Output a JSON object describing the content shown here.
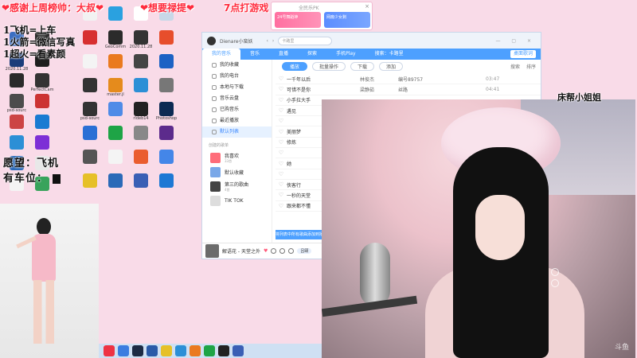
{
  "overlay": {
    "banner_left": "❤感谢上周榜帅：大叔❤",
    "banner_mid": "❤想要禄提❤",
    "banner_time": "7点打游戏",
    "rules": [
      "1飞机=上车",
      "1火箭=微信写真",
      "1超火=看素颜"
    ],
    "wish_title": "愿望：飞机",
    "wish_seats": "有车位：",
    "cam_label": "床帮小姐姐"
  },
  "pk_window": {
    "title": "全民乐PK",
    "left_label": "24号舞蹈神",
    "right_label": "网瘾少女剩",
    "close": "×"
  },
  "desktop_icons": [
    {
      "label": "",
      "color": "#3b6ec2"
    },
    {
      "label": "",
      "color": "#2a2a2a"
    },
    {
      "label": "",
      "color": "#f2f2f2"
    },
    {
      "label": "",
      "color": "#2aa1e0"
    },
    {
      "label": "",
      "color": "#ffffff"
    },
    {
      "label": "",
      "color": "#c8d8e8"
    },
    {
      "label": "2020.11.28",
      "color": "#1b3d7a"
    },
    {
      "label": "",
      "color": "#1e1e1e"
    },
    {
      "label": "",
      "color": "#d73030"
    },
    {
      "label": "GeoComm",
      "color": "#2b2b2b"
    },
    {
      "label": "2020.11.28",
      "color": "#333"
    },
    {
      "label": "",
      "color": "#e74e2c"
    },
    {
      "label": "",
      "color": "#2b2b2b"
    },
    {
      "label": "PerfectCam",
      "color": "#333"
    },
    {
      "label": "",
      "color": "#f4f4f4"
    },
    {
      "label": "",
      "color": "#ea7a1f"
    },
    {
      "label": "",
      "color": "#444"
    },
    {
      "label": "",
      "color": "#1d62c4"
    },
    {
      "label": "psd-sourc",
      "color": "#4c4c4c"
    },
    {
      "label": "",
      "color": "#c33"
    },
    {
      "label": "",
      "color": "#333"
    },
    {
      "label": "master.jl",
      "color": "#e58b1c"
    },
    {
      "label": "",
      "color": "#2c8fd6"
    },
    {
      "label": "",
      "color": "#777"
    },
    {
      "label": "",
      "color": "#c44"
    },
    {
      "label": "",
      "color": "#1a7bd2"
    },
    {
      "label": "psd-sourc",
      "color": "#333"
    },
    {
      "label": "",
      "color": "#4f8be7"
    },
    {
      "label": "rldeb14",
      "color": "#222"
    },
    {
      "label": "Photoshop",
      "color": "#0b2a53"
    },
    {
      "label": "",
      "color": "#2c8fd6"
    },
    {
      "label": "",
      "color": "#7d2ed6"
    },
    {
      "label": "",
      "color": "#2a6fd5"
    },
    {
      "label": "",
      "color": "#1ea446"
    },
    {
      "label": "",
      "color": "#888"
    },
    {
      "label": "",
      "color": "#5c2b8c"
    },
    {
      "label": "",
      "color": "#2b6ab8"
    },
    {
      "label": "",
      "color": "#e8e8e8"
    },
    {
      "label": "",
      "color": "#555"
    },
    {
      "label": "",
      "color": "#f4f4f4"
    },
    {
      "label": "",
      "color": "#ea5d2f"
    },
    {
      "label": "",
      "color": "#4486e8"
    },
    {
      "label": "",
      "color": "#f4f4f4"
    },
    {
      "label": "",
      "color": "#38a35b"
    },
    {
      "label": "",
      "color": "#e6c028"
    },
    {
      "label": "",
      "color": "#2b6ab8"
    },
    {
      "label": "",
      "color": "#3a5fb5"
    },
    {
      "label": "",
      "color": "#1e78d4"
    },
    {
      "label": "",
      "color": "#e8e8e8"
    },
    {
      "label": "",
      "color": "#2f7ad6"
    }
  ],
  "music_app": {
    "user_name": "Dienare小蛮妖",
    "search_placeholder": "卡路里",
    "tabs": [
      "我的音乐",
      "音乐",
      "直播",
      "探索",
      "手机Play",
      "搜索：卡路里"
    ],
    "lyric_button": "桌面歌词",
    "sidebar": {
      "items": [
        "我的收藏",
        "我的电台",
        "本地与下载",
        "音乐云盘",
        "已购音乐",
        "最近播放",
        "默认列表"
      ],
      "playlists_header": "创建的歌单",
      "playlists": [
        {
          "name": "我喜欢",
          "count": "33首",
          "color": "#ff6d7a"
        },
        {
          "name": "默认收藏",
          "count": "",
          "color": "#7aa8e8"
        },
        {
          "name": "第三的歌曲",
          "count": "4首",
          "color": "#444"
        },
        {
          "name": "TIK TOK",
          "count": "",
          "color": "#ddd"
        }
      ]
    },
    "toolbar": {
      "play": "播放",
      "batch": "批量操作",
      "download": "下载",
      "add": "添加",
      "search": "搜索",
      "sort": "排序"
    },
    "songs": [
      {
        "name": "一千年以后",
        "artist": "林俊杰",
        "album": "编号89757",
        "duration": "03:47"
      },
      {
        "name": "可惜不是你",
        "artist": "梁静茹",
        "album": "丝路",
        "duration": "04:41"
      },
      {
        "name": "小手拉大手",
        "artist": "",
        "album": "",
        "duration": ""
      },
      {
        "name": "遇见",
        "artist": "",
        "album": "",
        "duration": ""
      },
      {
        "name": "",
        "artist": "",
        "album": "",
        "duration": ""
      },
      {
        "name": "美丽梦",
        "artist": "",
        "album": "",
        "duration": ""
      },
      {
        "name": "修炼",
        "artist": "",
        "album": "",
        "duration": ""
      },
      {
        "name": "",
        "artist": "",
        "album": "",
        "duration": ""
      },
      {
        "name": "她",
        "artist": "",
        "album": "",
        "duration": ""
      },
      {
        "name": "",
        "artist": "",
        "album": "",
        "duration": ""
      },
      {
        "name": "侠客行",
        "artist": "",
        "album": "",
        "duration": ""
      },
      {
        "name": "一秒的天堂",
        "artist": "",
        "album": "",
        "duration": ""
      },
      {
        "name": "跟来都不懂",
        "artist": "",
        "album": "",
        "duration": ""
      }
    ],
    "queue_label": "将列表中所有歌曲添加到播放",
    "player": {
      "title": "解语花 - 天堂之外",
      "user": "吕颐"
    }
  },
  "camera": {
    "logo": "斗鱼"
  }
}
